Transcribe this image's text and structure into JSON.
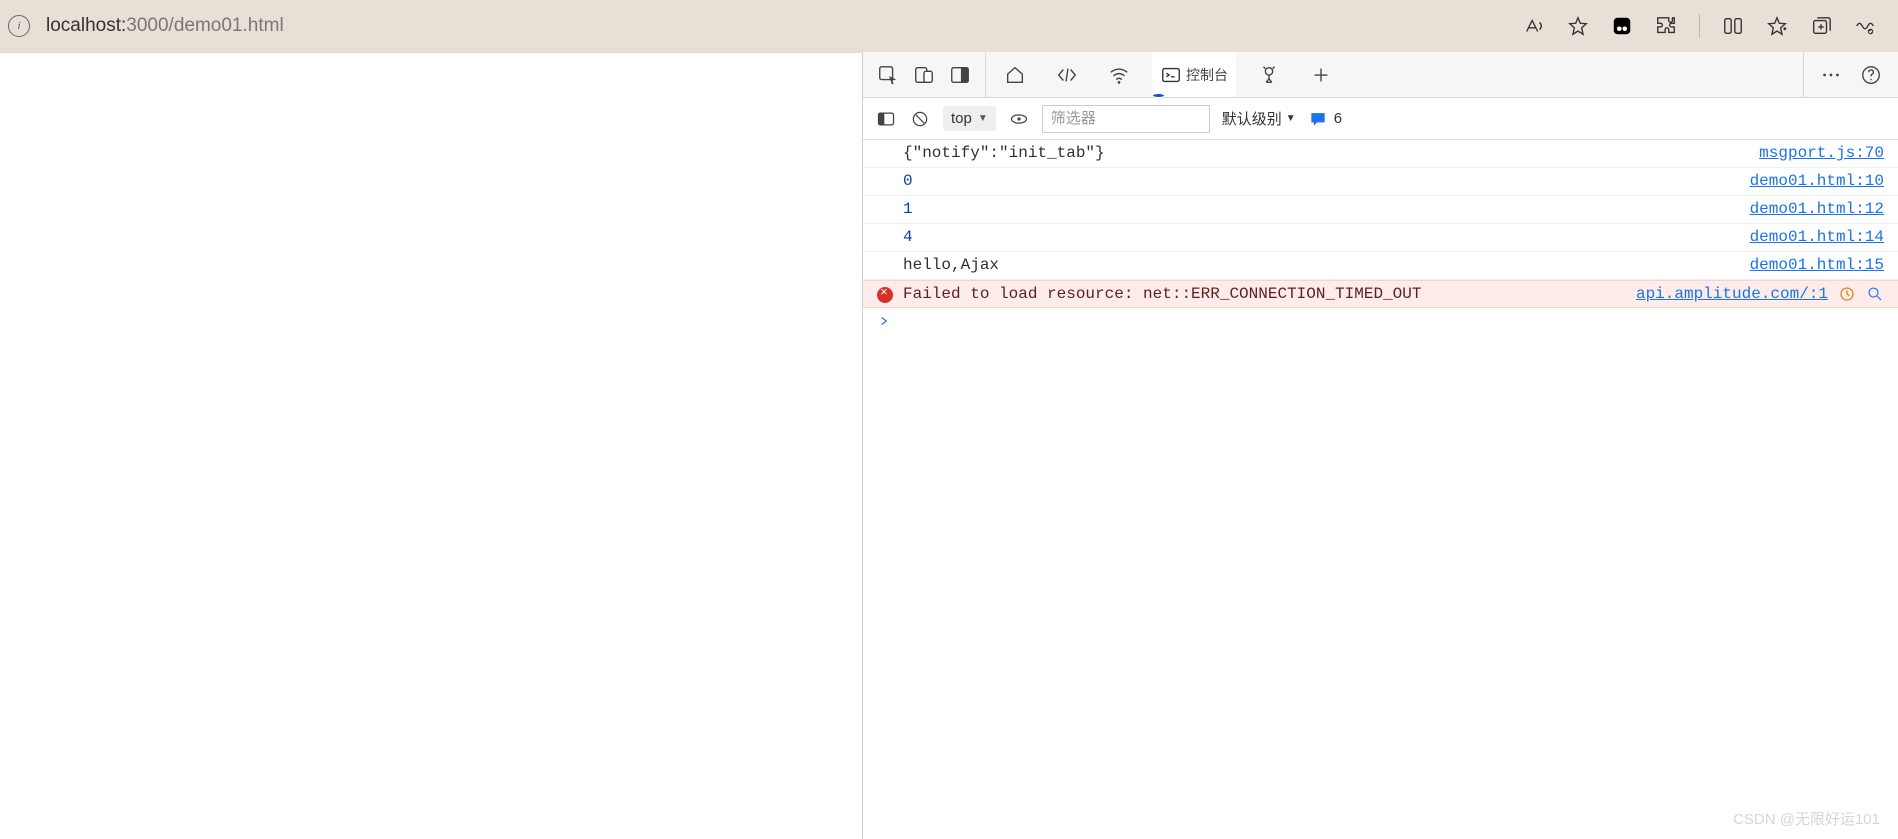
{
  "browser": {
    "url_host": "localhost:",
    "url_rest": "3000/demo01.html"
  },
  "devtools": {
    "active_tab_label": "控制台",
    "toolbar": {
      "context": "top",
      "filter_placeholder": "筛选器",
      "level_label": "默认级别",
      "issue_count": "6"
    }
  },
  "console": {
    "messages": [
      {
        "kind": "plain",
        "text": "{\"notify\":\"init_tab\"}",
        "src": "msgport.js:70",
        "link": true
      },
      {
        "kind": "num",
        "text": "0",
        "src": "demo01.html:10",
        "link": true
      },
      {
        "kind": "num",
        "text": "1",
        "src": "demo01.html:12",
        "link": true
      },
      {
        "kind": "num",
        "text": "4",
        "src": "demo01.html:14",
        "link": true
      },
      {
        "kind": "plain",
        "text": "hello,Ajax",
        "src": "demo01.html:15",
        "link": true
      },
      {
        "kind": "err",
        "text": "Failed to load resource: net::ERR_CONNECTION_TIMED_OUT",
        "src": "api.amplitude.com/:1",
        "link": true
      }
    ]
  },
  "watermark": "CSDN @无限好运101"
}
